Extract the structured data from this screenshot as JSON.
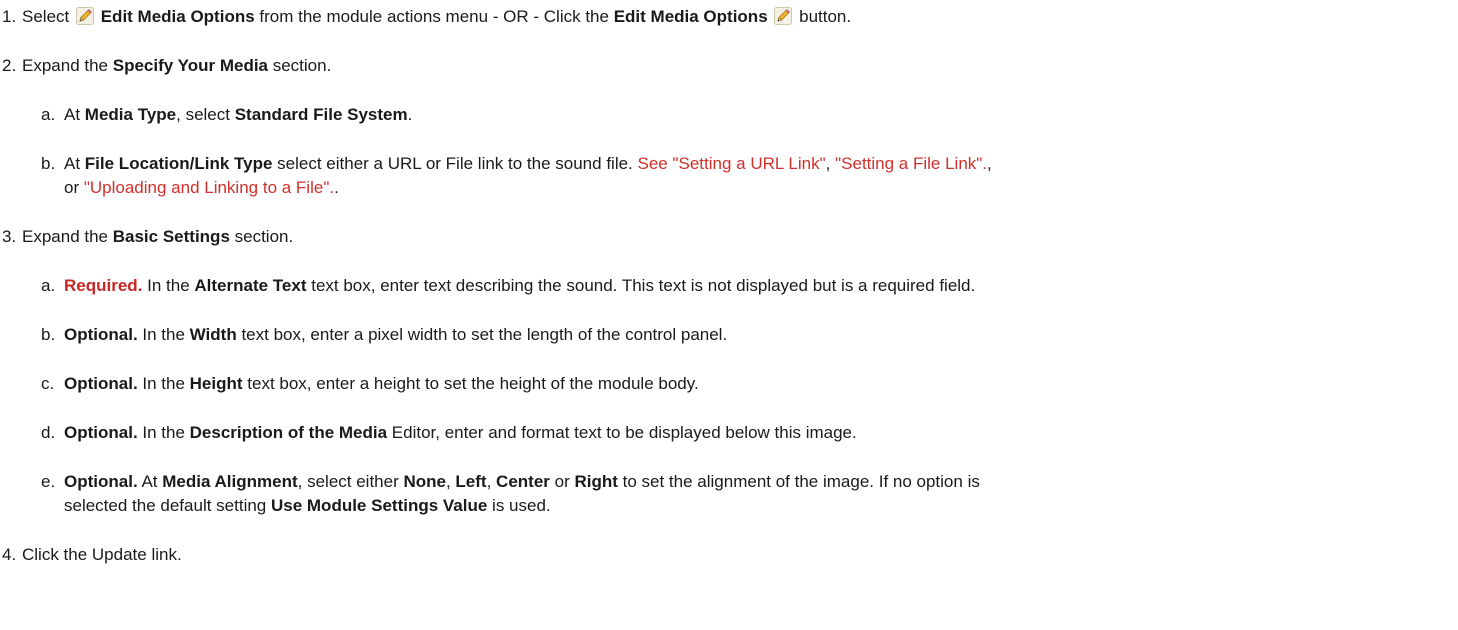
{
  "steps": [
    {
      "num": "1.",
      "pre": "Select ",
      "b1": "Edit Media Options",
      "mid": " from the module actions menu - OR - Click the ",
      "b2": "Edit Media Options",
      "post": " button.",
      "icon": "pencil-icon"
    },
    {
      "num": "2.",
      "pre": "Expand the ",
      "b1": "Specify Your Media",
      "post": " section."
    },
    {
      "num": "a.",
      "pre": "At ",
      "b1": "Media Type",
      "mid": ", select ",
      "b2": "Standard File System",
      "post": "."
    },
    {
      "num": "b.",
      "pre": "At ",
      "b1": "File Location/Link Type",
      "mid": " select either a URL or File link to the sound file. ",
      "link1": "See \"Setting a URL Link\"",
      "sep1": ", ",
      "link2": "\"Setting a File Link\".",
      "sep2": ",",
      "cont_pre": "or ",
      "link3": "\"Uploading and Linking to a File\".",
      "cont_post": "."
    },
    {
      "num": "3.",
      "pre": "Expand the ",
      "b1": "Basic Settings",
      "post": " section."
    },
    {
      "num": "a.",
      "req": "Required.",
      "pre": " In the ",
      "b1": "Alternate Text",
      "post": " text box, enter text describing the sound. This text is not displayed but is a required field."
    },
    {
      "num": "b.",
      "opt": "Optional.",
      "pre": " In the ",
      "b1": "Width",
      "post": " text box, enter a pixel width to set the length of the control panel."
    },
    {
      "num": "c.",
      "opt": "Optional.",
      "pre": " In the ",
      "b1": "Height",
      "post": " text box, enter a height to set the height of the module body."
    },
    {
      "num": "d.",
      "opt": "Optional.",
      "pre": " In the ",
      "b1": "Description of the Media",
      "post": " Editor, enter and format text to be displayed below this image."
    },
    {
      "num": "e.",
      "opt": "Optional.",
      "pre": " At ",
      "b1": "Media Alignment",
      "mid1": ", select either ",
      "o1": "None",
      "c1": ", ",
      "o2": "Left",
      "c2": ", ",
      "o3": "Center",
      "c3": " or ",
      "o4": "Right",
      "post": " to set the alignment of the image. If no option is",
      "cont_pre": "selected the default setting ",
      "cont_b": "Use Module Settings Value",
      "cont_post": " is used."
    },
    {
      "num": "4.",
      "text": "Click the Update link."
    }
  ],
  "colors": {
    "text": "#1a1a1a",
    "link": "#d0312d",
    "required": "#c62828"
  }
}
